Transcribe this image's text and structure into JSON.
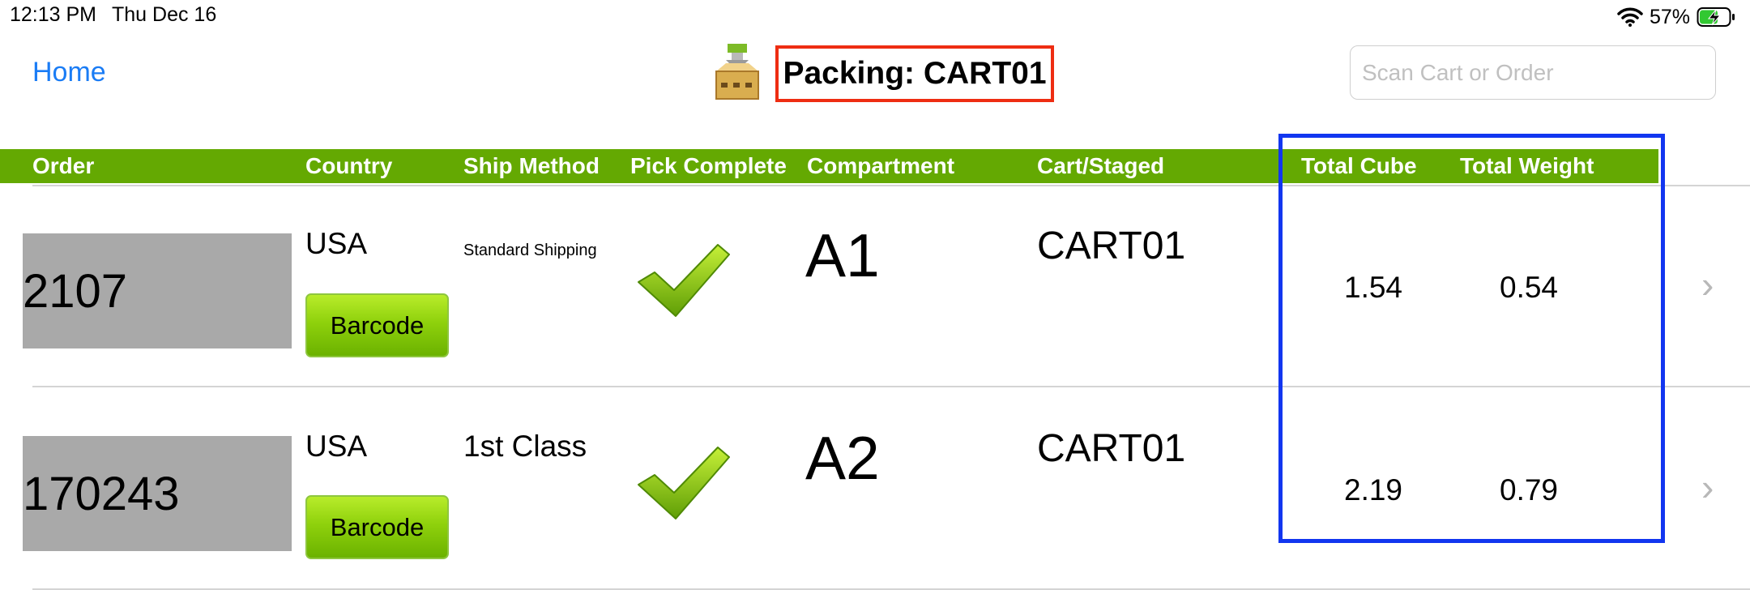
{
  "status_bar": {
    "time": "12:13 PM",
    "date": "Thu Dec 16",
    "battery": "57%",
    "icons": [
      "wifi-icon",
      "battery-charging-icon"
    ]
  },
  "header": {
    "home_label": "Home",
    "title": "Packing: CART01",
    "search_placeholder": "Scan Cart or Order",
    "title_icon": "packing-box-icon"
  },
  "columns": [
    "Order",
    "Country",
    "Ship Method",
    "Pick Complete",
    "Compartment",
    "Cart/Staged",
    "Total Cube",
    "Total Weight"
  ],
  "rows": [
    {
      "order": "2107",
      "country": "USA",
      "barcode_label": "Barcode",
      "ship_method": "Standard Shipping",
      "pick_complete": true,
      "compartment": "A1",
      "cart_staged": "CART01",
      "total_cube": "1.54",
      "total_weight": "0.54"
    },
    {
      "order": "170243",
      "country": "USA",
      "barcode_label": "Barcode",
      "ship_method": "1st Class",
      "pick_complete": true,
      "compartment": "A2",
      "cart_staged": "CART01",
      "total_cube": "2.19",
      "total_weight": "0.79"
    }
  ],
  "colors": {
    "accent": "#1a7cf5",
    "header_band": "#64a902",
    "order_bg": "#a9a9a9",
    "highlight_red": "#ee2d12",
    "highlight_blue": "#1236f0"
  }
}
